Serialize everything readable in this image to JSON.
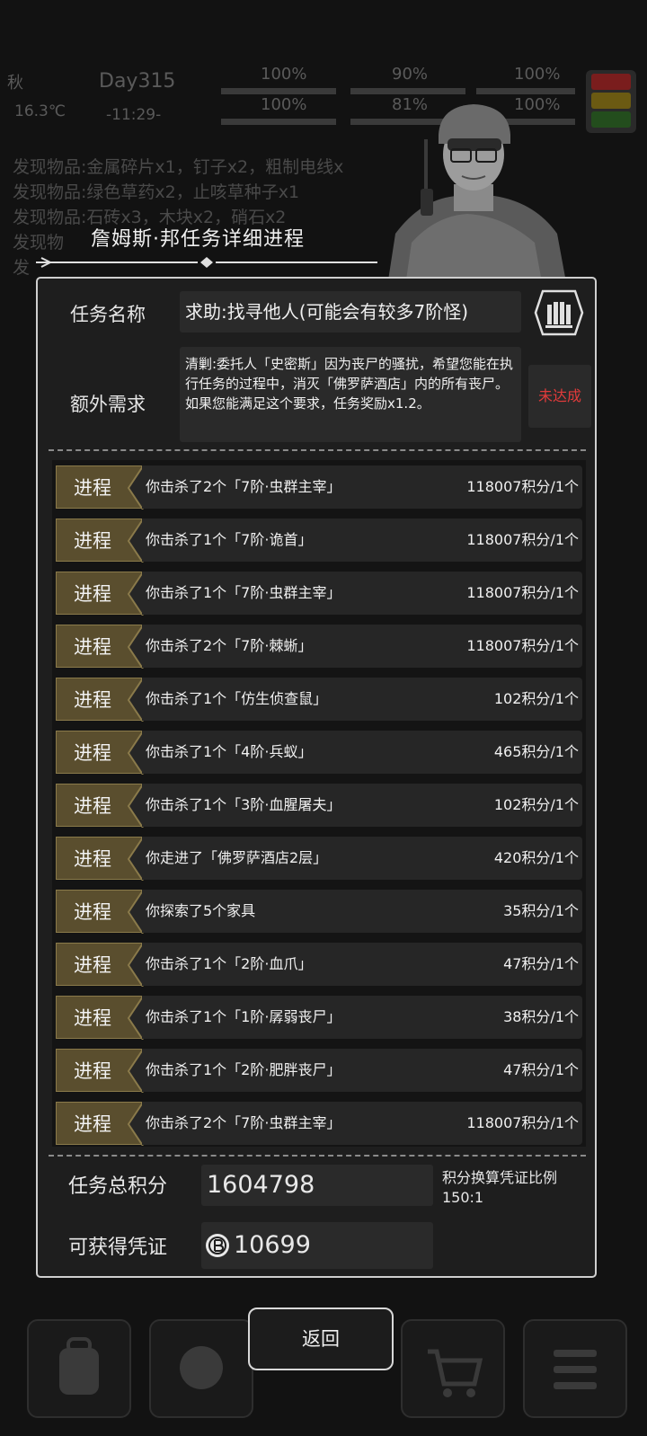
{
  "hud": {
    "season": "秋",
    "temperature": "16.3℃",
    "day": "Day315",
    "time": "-11:29-",
    "stats": [
      "100%",
      "90%",
      "100%",
      "100%",
      "81%",
      "100%"
    ]
  },
  "log_lines": [
    "发现物品:金属碎片x1，钉子x2，粗制电线x",
    "发现物品:绿色草药x2，止咳草种子x1",
    "发现物品:石砖x3，木块x2，硝石x2",
    "发现物",
    "发"
  ],
  "title": "詹姆斯·邦任务详细进程",
  "task": {
    "name_label": "任务名称",
    "name": "求助:找寻他人(可能会有较多7阶怪)",
    "extra_label": "额外需求",
    "extra_text": "清剿:委托人「史密斯」因为丧尸的骚扰，希望您能在执行任务的过程中，消灭「佛罗萨酒店」内的所有丧尸。如果您能满足这个要求，任务奖励x1.2。",
    "extra_status": "未达成",
    "status_color": "#e23b3b"
  },
  "progress_tag": "进程",
  "progress": [
    {
      "desc": "你击杀了2个「7阶·虫群主宰」",
      "score": "118007积分/1个"
    },
    {
      "desc": "你击杀了1个「7阶·诡首」",
      "score": "118007积分/1个"
    },
    {
      "desc": "你击杀了1个「7阶·虫群主宰」",
      "score": "118007积分/1个"
    },
    {
      "desc": "你击杀了2个「7阶·棘蜥」",
      "score": "118007积分/1个"
    },
    {
      "desc": "你击杀了1个「仿生侦查鼠」",
      "score": "102积分/1个"
    },
    {
      "desc": "你击杀了1个「4阶·兵蚁」",
      "score": "465积分/1个"
    },
    {
      "desc": "你击杀了1个「3阶·血腥屠夫」",
      "score": "102积分/1个"
    },
    {
      "desc": "你走进了「佛罗萨酒店2层」",
      "score": "420积分/1个"
    },
    {
      "desc": "你探索了5个家具",
      "score": "35积分/1个"
    },
    {
      "desc": "你击杀了1个「2阶·血爪」",
      "score": "47积分/1个"
    },
    {
      "desc": "你击杀了1个「1阶·孱弱丧尸」",
      "score": "38积分/1个"
    },
    {
      "desc": "你击杀了1个「2阶·肥胖丧尸」",
      "score": "47积分/1个"
    },
    {
      "desc": "你击杀了2个「7阶·虫群主宰」",
      "score": "118007积分/1个"
    }
  ],
  "summary": {
    "total_label": "任务总积分",
    "total_value": "1604798",
    "ratio_label": "积分换算凭证比例",
    "ratio_value": "150:1",
    "voucher_label": "可获得凭证",
    "voucher_value": "10699"
  },
  "back_label": "返回",
  "nav_icons": [
    "backpack-icon",
    "brain-icon",
    "cart-icon",
    "menu-icon"
  ]
}
